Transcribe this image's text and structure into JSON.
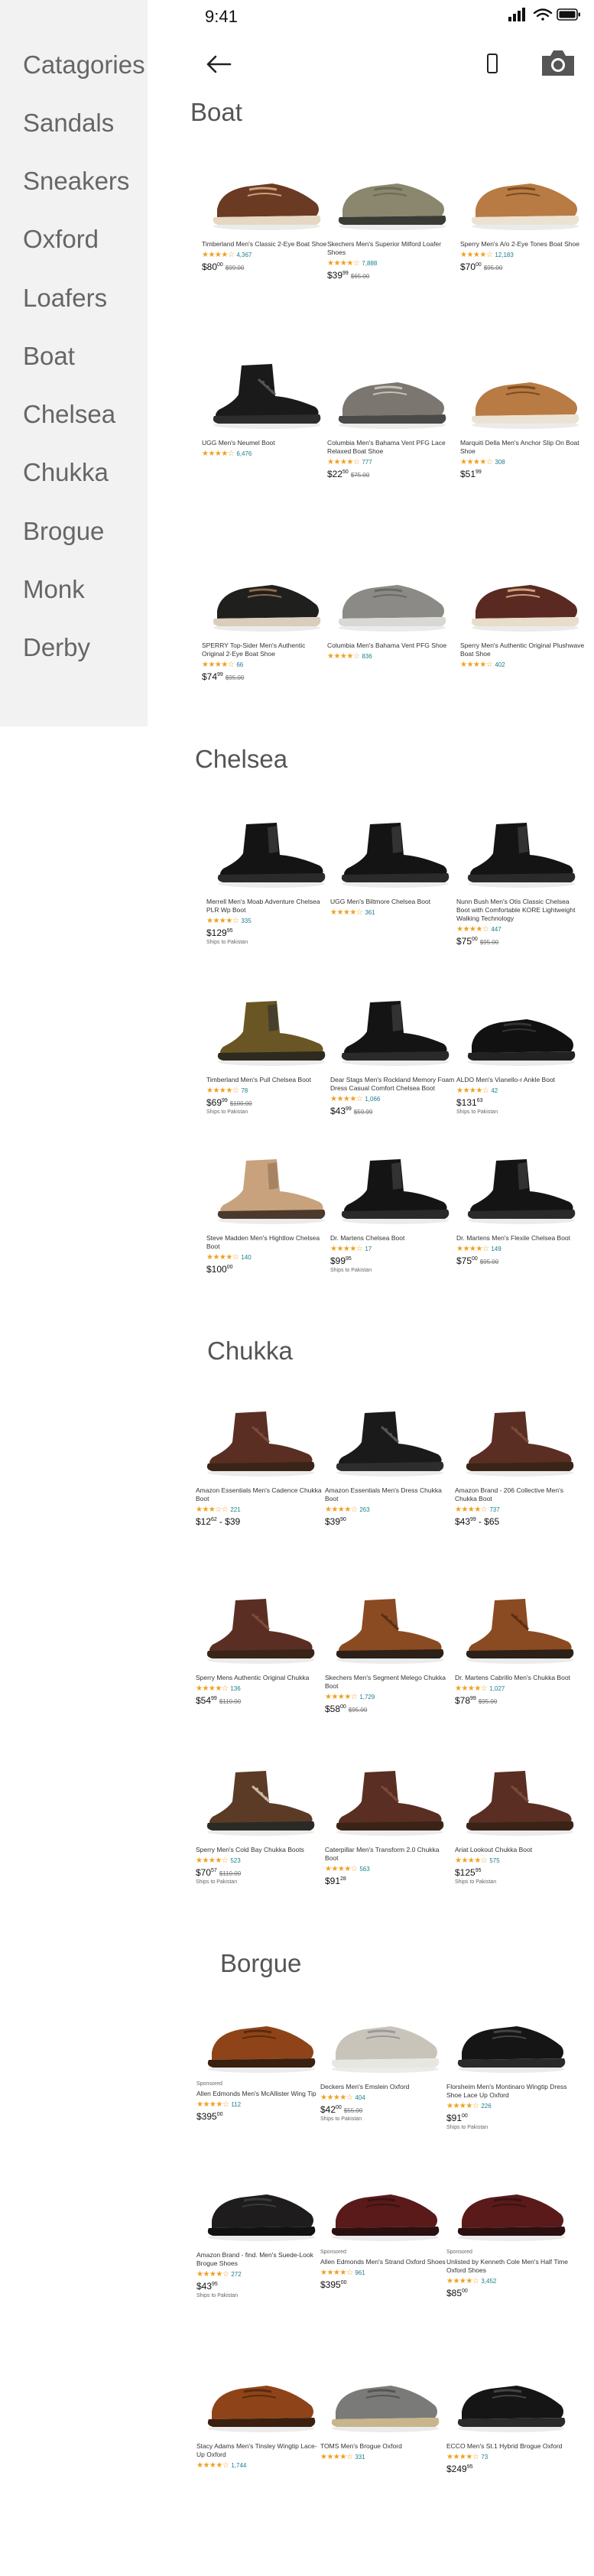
{
  "status": {
    "time": "9:41"
  },
  "sidebar": {
    "title": "Catagories",
    "items": [
      "Sandals",
      "Sneakers",
      "Oxford",
      "Loafers",
      "Boat",
      "Chelsea",
      "Chukka",
      "Brogue",
      "Monk",
      "Derby"
    ]
  },
  "icons": {
    "back": "back-arrow-icon",
    "phone": "phone-icon",
    "camera": "camera-icon"
  },
  "colors": {
    "sidebar_bg": "#f2f2f2",
    "star": "#f0a020",
    "link": "#1a7f8e"
  },
  "sections": [
    {
      "heading": "Boat",
      "products": [
        {
          "name": "Timberland Men's Classic 2-Eye Boat Shoe",
          "stars": "★★★★☆",
          "reviews": "4,367",
          "price": "$80",
          "price_cents": "00",
          "old": "$99.00",
          "shoe": "brown-boat"
        },
        {
          "name": "Skechers Men's Superior Milford Loafer Shoes",
          "stars": "★★★★☆",
          "reviews": "7,888",
          "price": "$39",
          "price_cents": "99",
          "old": "$65.00",
          "shoe": "olive-slip"
        },
        {
          "name": "Sperry Men's A/o 2-Eye Tones Boat Shoe",
          "stars": "★★★★☆",
          "reviews": "12,183",
          "price": "$70",
          "price_cents": "00",
          "old": "$95.00",
          "shoe": "tan-boat"
        },
        {
          "name": "UGG Men's Neumel Boot",
          "stars": "★★★★☆",
          "reviews": "6,476",
          "price": "",
          "price_cents": "",
          "old": "",
          "shoe": "black-chukka"
        },
        {
          "name": "Columbia Men's Bahama Vent PFG Lace Relaxed Boat Shoe",
          "stars": "★★★★☆",
          "reviews": "777",
          "price": "$22",
          "price_cents": "50",
          "old": "$75.00",
          "shoe": "grey-boat"
        },
        {
          "name": "Marquiti Della Men's Anchor Slip On Boat Shoe",
          "stars": "★★★★☆",
          "reviews": "308",
          "price": "$51",
          "price_cents": "99",
          "old": "",
          "shoe": "tan-boat"
        },
        {
          "name": "SPERRY Top-Sider Men's Authentic Original 2-Eye Boat Shoe",
          "stars": "★★★★☆",
          "reviews": "66",
          "price": "$74",
          "price_cents": "99",
          "old": "$95.00",
          "shoe": "black-boat"
        },
        {
          "name": "Columbia Men's Bahama Vent PFG Shoe",
          "stars": "★★★★☆",
          "reviews": "836",
          "price": "",
          "price_cents": "",
          "old": "",
          "shoe": "grey-slip"
        },
        {
          "name": "Sperry Men's Authentic Original Plushwave Boat Shoe",
          "stars": "★★★★☆",
          "reviews": "402",
          "price": "",
          "price_cents": "",
          "old": "",
          "shoe": "burgundy-boat"
        }
      ]
    },
    {
      "heading": "Chelsea",
      "products": [
        {
          "name": "Merrell Men's Moab Adventure Chelsea PLR Wp Boot",
          "stars": "★★★★☆",
          "reviews": "335",
          "price": "$129",
          "price_cents": "95",
          "old": "",
          "sub": "Ships to Pakistan",
          "shoe": "black-chelsea"
        },
        {
          "name": "UGG Men's Biltmore Chelsea Boot",
          "stars": "★★★★☆",
          "reviews": "361",
          "price": "",
          "price_cents": "",
          "old": "",
          "shoe": "black-chelsea"
        },
        {
          "name": "Nunn Bush Men's Otis Classic Chelsea Boot with Comfortable KORE Lightweight Walking Technology",
          "stars": "★★★★☆",
          "reviews": "447",
          "price": "$75",
          "price_cents": "00",
          "old": "$95.00",
          "shoe": "black-chelsea"
        },
        {
          "name": "Timberland Men's Pull Chelsea Boot",
          "stars": "★★★★☆",
          "reviews": "78",
          "price": "$69",
          "price_cents": "99",
          "old": "$100.00",
          "sub": "Ships to Pakistan",
          "shoe": "olive-chelsea"
        },
        {
          "name": "Dear Stags Men's Rockland Memory Foam Dress Casual Comfort Chelsea Boot",
          "stars": "★★★★☆",
          "reviews": "1,066",
          "price": "$43",
          "price_cents": "99",
          "old": "$59.99",
          "shoe": "black-chelsea"
        },
        {
          "name": "ALDO Men's Vianello-r Ankle Boot",
          "stars": "★★★★☆",
          "reviews": "42",
          "price": "$131",
          "price_cents": "63",
          "old": "",
          "sub": "Ships to Pakistan",
          "shoe": "black-low"
        },
        {
          "name": "Steve Madden Men's Hightlow Chelsea Boot",
          "stars": "★★★★☆",
          "reviews": "140",
          "price": "$100",
          "price_cents": "00",
          "old": "",
          "shoe": "tan-chelsea"
        },
        {
          "name": "Dr. Martens Chelsea Boot",
          "stars": "★★★★☆",
          "reviews": "17",
          "price": "$99",
          "price_cents": "95",
          "old": "",
          "sub": "Ships to Pakistan",
          "shoe": "black-chelsea"
        },
        {
          "name": "Dr. Martens Men's Flexile Chelsea Boot",
          "stars": "★★★★☆",
          "reviews": "149",
          "price": "$75",
          "price_cents": "00",
          "old": "$95.00",
          "shoe": "black-chelsea"
        }
      ]
    },
    {
      "heading": "Chukka",
      "products": [
        {
          "name": "Amazon Essentials Men's Cadence Chukka Boot",
          "stars": "★★★☆☆",
          "reviews": "221",
          "price": "$12",
          "price_cents": "62",
          "price_extra": "- $39",
          "old": "",
          "shoe": "brown-chukka"
        },
        {
          "name": "Amazon Essentials Men's Dress Chukka Boot",
          "stars": "★★★★☆",
          "reviews": "263",
          "price": "$39",
          "price_cents": "90",
          "old": "",
          "shoe": "black-chukka"
        },
        {
          "name": "Amazon Brand - 206 Collective Men's Chukka Boot",
          "stars": "★★★★☆",
          "reviews": "737",
          "price": "$43",
          "price_cents": "99",
          "price_extra": "- $65",
          "old": "",
          "shoe": "brown-chukka"
        },
        {
          "name": "Sperry Mens Authentic Original Chukka",
          "stars": "★★★★☆",
          "reviews": "136",
          "price": "$54",
          "price_cents": "99",
          "old": "$110.00",
          "shoe": "brown-chukka"
        },
        {
          "name": "Skechers Men's Segment Melego Chukka Boot",
          "stars": "★★★★☆",
          "reviews": "1,729",
          "price": "$58",
          "price_cents": "00",
          "old": "$95.00",
          "shoe": "rust-chukka"
        },
        {
          "name": "Dr. Martens Cabrillo Men's Chukka Boot",
          "stars": "★★★★☆",
          "reviews": "1,027",
          "price": "$78",
          "price_cents": "99",
          "old": "$95.00",
          "shoe": "rust-chukka"
        },
        {
          "name": "Sperry Men's Cold Bay Chukka Boots",
          "stars": "★★★★☆",
          "reviews": "523",
          "price": "$70",
          "price_cents": "57",
          "old": "$110.00",
          "sub": "Ships to Pakistan",
          "shoe": "brown-duck"
        },
        {
          "name": "Caterpillar Men's Transform 2.0 Chukka Boot",
          "stars": "★★★★☆",
          "reviews": "563",
          "price": "$91",
          "price_cents": "28",
          "old": "",
          "shoe": "brown-chukka"
        },
        {
          "name": "Ariat Lookout Chukka Boot",
          "stars": "★★★★☆",
          "reviews": "575",
          "price": "$125",
          "price_cents": "95",
          "old": "",
          "sub": "Ships to Pakistan",
          "shoe": "brown-chukka"
        }
      ]
    },
    {
      "heading": "Borgue",
      "products": [
        {
          "name": "Allen Edmonds Men's McAllister Wing Tip",
          "stars": "★★★★☆",
          "reviews": "112",
          "price": "$395",
          "price_cents": "00",
          "old": "",
          "badge": "Sponsored",
          "shoe": "cognac-brogue"
        },
        {
          "name": "Deckers Men's Emslein Oxford",
          "stars": "★★★★☆",
          "reviews": "404",
          "price": "$42",
          "price_cents": "00",
          "old": "$55.00",
          "sub": "Ships to Pakistan",
          "shoe": "grey-brogue"
        },
        {
          "name": "Florsheim Men's Montinaro Wingtip Dress Shoe Lace Up Oxford",
          "stars": "★★★★☆",
          "reviews": "226",
          "price": "$91",
          "price_cents": "00",
          "old": "",
          "sub": "Ships to Pakistan",
          "shoe": "black-oxford"
        },
        {
          "name": "Amazon Brand - find. Men's Suede-Look Brogue Shoes",
          "stars": "★★★★☆",
          "reviews": "272",
          "price": "$43",
          "price_cents": "95",
          "old": "",
          "sub": "Ships to Pakistan",
          "shoe": "black-suede"
        },
        {
          "name": "Allen Edmonds Men's Strand Oxford Shoes",
          "stars": "★★★★☆",
          "reviews": "961",
          "price": "$395",
          "price_cents": "00",
          "old": "",
          "badge": "Sponsored",
          "shoe": "burgundy-oxford"
        },
        {
          "name": "Unlisted by Kenneth Cole Men's Half Time Oxford Shoes",
          "stars": "★★★★☆",
          "reviews": "3,452",
          "price": "$85",
          "price_cents": "00",
          "old": "",
          "badge": "Sponsored",
          "shoe": "burgundy-oxford"
        },
        {
          "name": "Stacy Adams Men's Tinsley Wingtip Lace-Up Oxford",
          "stars": "★★★★☆",
          "reviews": "1,744",
          "price": "",
          "price_cents": "",
          "old": "",
          "shoe": "cognac-brogue"
        },
        {
          "name": "TOMS Men's Brogue Oxford",
          "stars": "★★★★☆",
          "reviews": "331",
          "price": "",
          "price_cents": "",
          "old": "",
          "shoe": "grey-canvas"
        },
        {
          "name": "ECCO Men's St.1 Hybrid Brogue Oxford",
          "stars": "★★★★☆",
          "reviews": "73",
          "price": "$249",
          "price_cents": "95",
          "old": "",
          "shoe": "black-oxford"
        }
      ]
    }
  ]
}
